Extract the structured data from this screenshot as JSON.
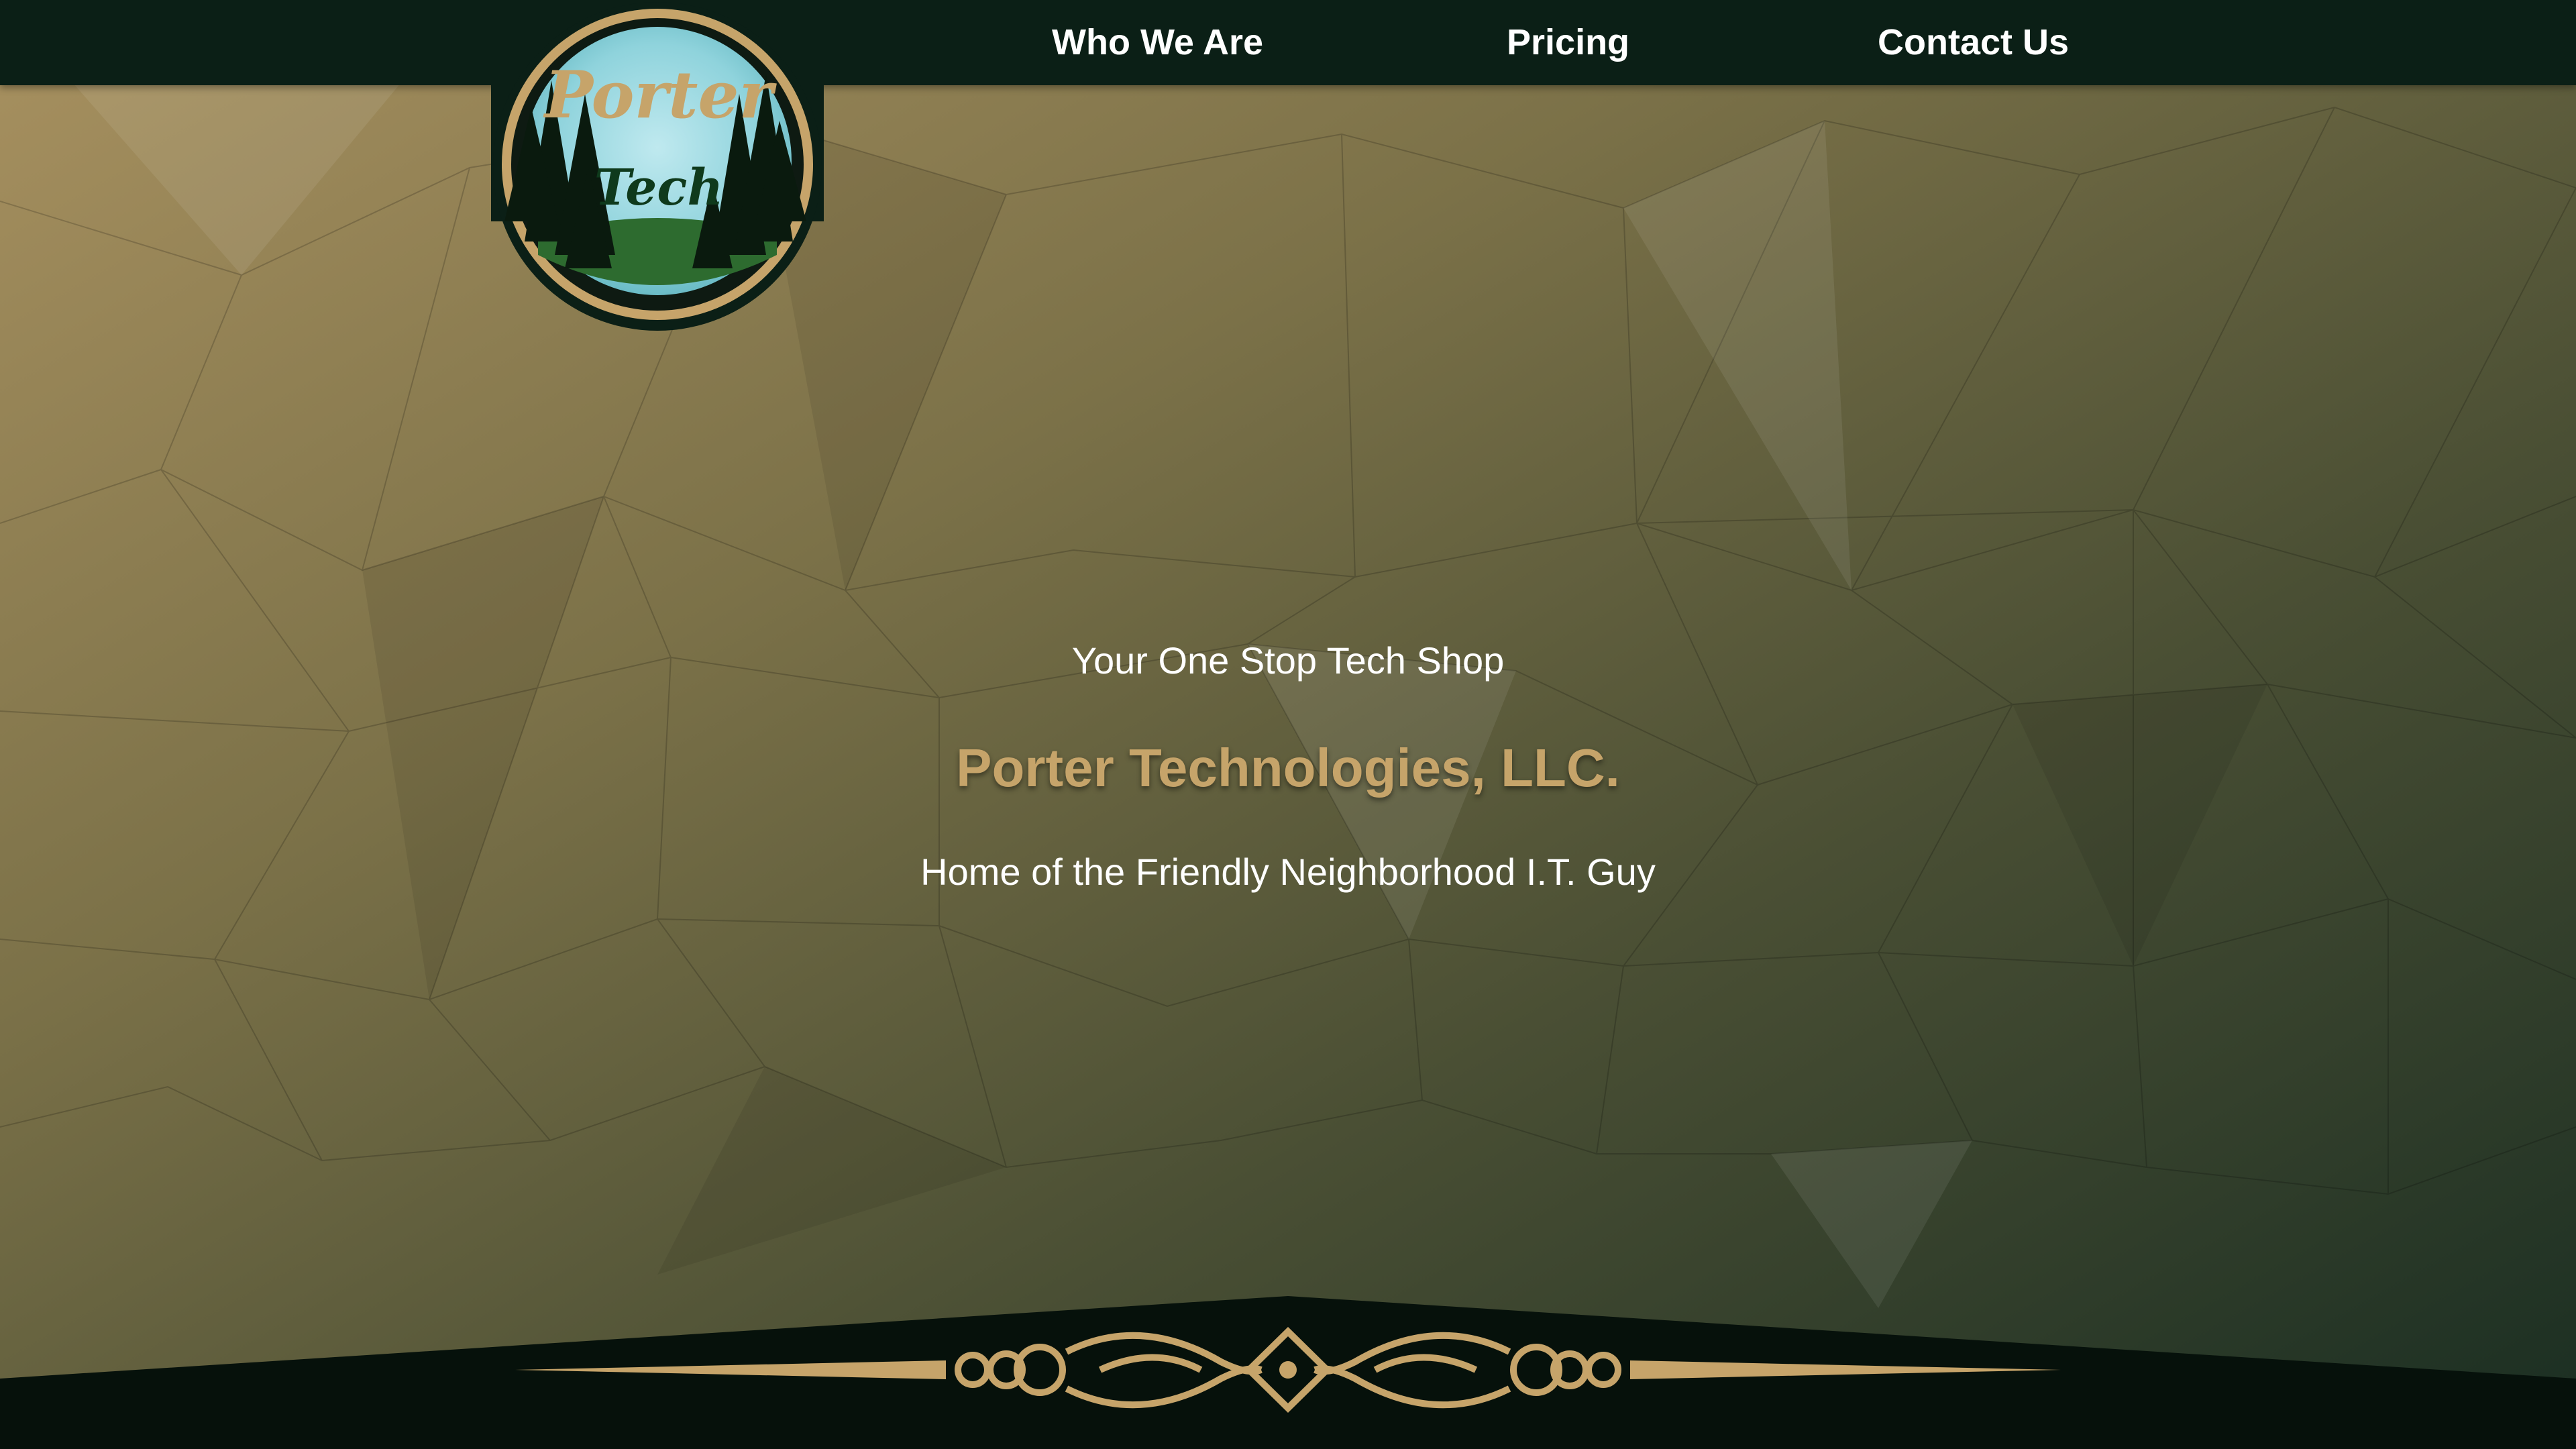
{
  "nav": {
    "items": [
      {
        "label": "Who We Are"
      },
      {
        "label": "Pricing"
      },
      {
        "label": "Contact Us"
      }
    ]
  },
  "logo": {
    "line1": "Porter",
    "line2": "Tech"
  },
  "hero": {
    "tagline": "Your One Stop Tech Shop",
    "title": "Porter Technologies, LLC.",
    "subtitle": "Home of the Friendly Neighborhood I.T. Guy"
  },
  "colors": {
    "navbar": "#0b1f16",
    "accent_gold": "#c6a46a",
    "bg_light": "#a08a55",
    "bg_dark": "#1b3222"
  }
}
